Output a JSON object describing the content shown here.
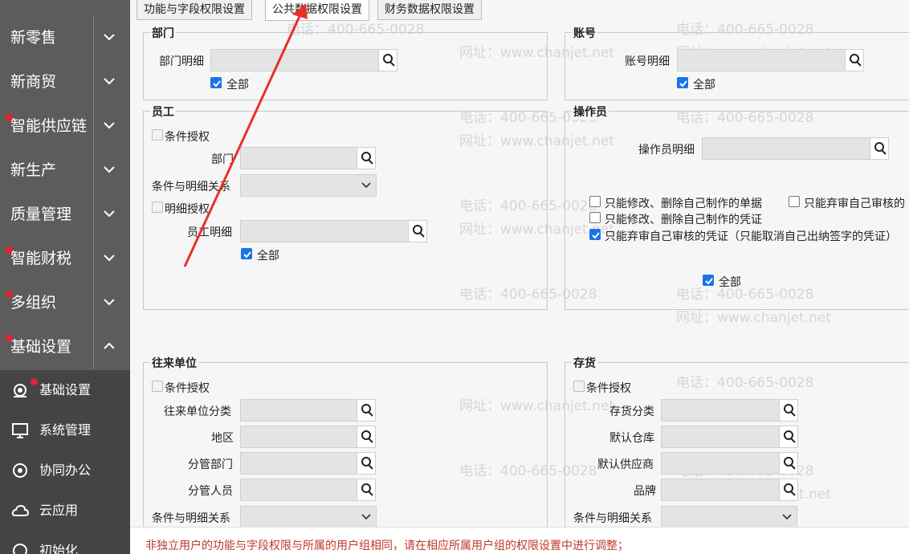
{
  "sidebar": {
    "items": [
      {
        "label": "新零售",
        "dot": false
      },
      {
        "label": "新商贸",
        "dot": false
      },
      {
        "label": "智能供应链",
        "dot": true
      },
      {
        "label": "新生产",
        "dot": false
      },
      {
        "label": "质量管理",
        "dot": false
      },
      {
        "label": "智能财税",
        "dot": true
      },
      {
        "label": "多组织",
        "dot": true
      },
      {
        "label": "基础设置",
        "dot": true
      }
    ],
    "sub_items": [
      {
        "label": "基础设置",
        "icon": "gear-icon"
      },
      {
        "label": "系统管理",
        "icon": "monitor-icon"
      },
      {
        "label": "协同办公",
        "icon": "sync-icon"
      },
      {
        "label": "云应用",
        "icon": "cloud-icon"
      },
      {
        "label": "初始化",
        "icon": "init-icon"
      }
    ]
  },
  "tabs": [
    "功能与字段权限设置",
    "公共数据权限设置",
    "财务数据权限设置"
  ],
  "active_tab": 1,
  "dept": {
    "title": "部门",
    "detail_label": "部门明细",
    "all_label": "全部"
  },
  "account": {
    "title": "账号",
    "detail_label": "账号明细",
    "all_label": "全部"
  },
  "employee": {
    "title": "员工",
    "cond_auth": "条件授权",
    "dept_label": "部门",
    "relation_label": "条件与明细关系",
    "detail_auth": "明细授权",
    "emp_detail_label": "员工明细",
    "all_label": "全部"
  },
  "operator": {
    "title": "操作员",
    "detail_label": "操作员明细",
    "opt1": "只能修改、删除自己制作的单据",
    "opt2": "只能弃审自己审核的",
    "opt3": "只能修改、删除自己制作的凭证",
    "opt4": "只能弃审自己审核的凭证（只能取消自己出纳签字的凭证）",
    "all_label": "全部"
  },
  "partner": {
    "title": "往来单位",
    "cond_auth": "条件授权",
    "category_label": "往来单位分类",
    "region_label": "地区",
    "dept_label": "分管部门",
    "person_label": "分管人员",
    "relation_label": "条件与明细关系"
  },
  "inventory": {
    "title": "存货",
    "cond_auth": "条件授权",
    "category_label": "存货分类",
    "warehouse_label": "默认仓库",
    "supplier_label": "默认供应商",
    "brand_label": "品牌",
    "relation_label": "条件与明细关系"
  },
  "watermark": {
    "phone": "电话：400-665-0028",
    "site": "网址：www.chanjet.net"
  },
  "notice": "非独立用户的功能与字段权限与所属的用户组相同，请在相应所属用户组的权限设置中进行调整；",
  "colors": {
    "sidebar": "#5c5c5c",
    "sub": "#444444",
    "dot": "#e0242f",
    "check": "#1a73e8",
    "arrow": "#e8312a",
    "notice": "#c0392b"
  }
}
